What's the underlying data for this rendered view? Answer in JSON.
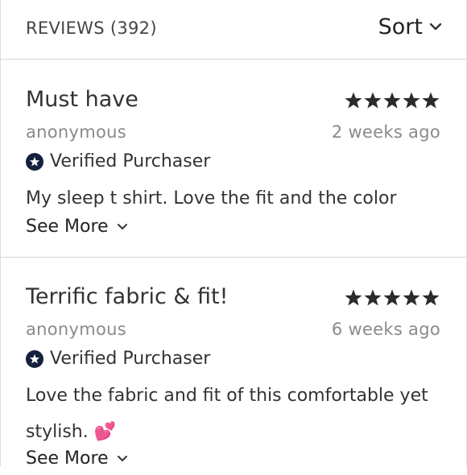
{
  "header": {
    "title": "REVIEWS (392)",
    "sort_label": "Sort"
  },
  "reviews": [
    {
      "title": "Must have",
      "rating": 5,
      "author": "anonymous",
      "date": "2 weeks ago",
      "verified_label": "Verified Purchaser",
      "body": "My sleep t shirt. Love the fit and the color",
      "see_more_label": "See More"
    },
    {
      "title": "Terrific fabric & fit!",
      "rating": 5,
      "author": "anonymous",
      "date": "6 weeks ago",
      "verified_label": "Verified Purchaser",
      "body_line1": "Love the fabric and fit of this comfortable yet",
      "body_line2": "stylish.",
      "emoji": "💕",
      "see_more_label": "See More"
    }
  ],
  "colors": {
    "badge": "#14213d",
    "muted_text": "#8a8a8a",
    "divider": "#d6d6d6"
  },
  "icons": [
    "chevron-down-icon",
    "star-icon",
    "verified-star-icon",
    "two-hearts-emoji"
  ]
}
